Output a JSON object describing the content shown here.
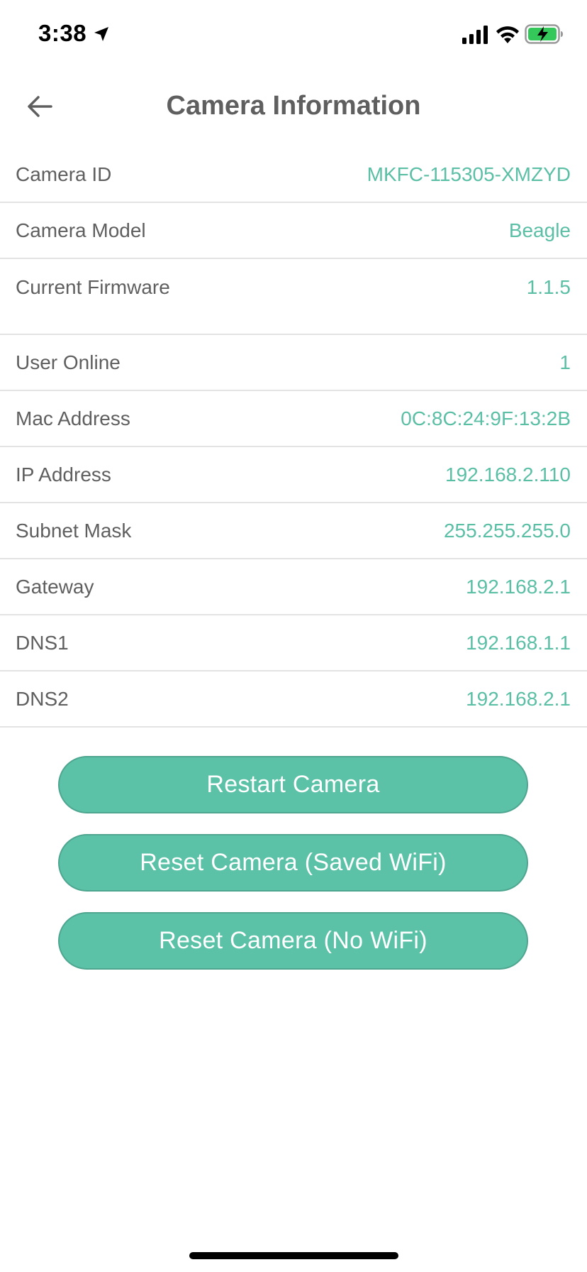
{
  "status_bar": {
    "time": "3:38"
  },
  "header": {
    "title": "Camera Information"
  },
  "info": [
    {
      "label": "Camera ID",
      "value": "MKFC-115305-XMZYD"
    },
    {
      "label": "Camera Model",
      "value": "Beagle"
    },
    {
      "label": "Current Firmware",
      "value": "1.1.5"
    },
    {
      "label": "User Online",
      "value": "1"
    },
    {
      "label": "Mac Address",
      "value": "0C:8C:24:9F:13:2B"
    },
    {
      "label": "IP Address",
      "value": "192.168.2.110"
    },
    {
      "label": "Subnet Mask",
      "value": "255.255.255.0"
    },
    {
      "label": "Gateway",
      "value": "192.168.2.1"
    },
    {
      "label": "DNS1",
      "value": "192.168.1.1"
    },
    {
      "label": "DNS2",
      "value": "192.168.2.1"
    }
  ],
  "actions": {
    "restart_label": "Restart Camera",
    "reset_saved_wifi_label": "Reset Camera (Saved WiFi)",
    "reset_no_wifi_label": "Reset Camera (No WiFi)"
  },
  "colors": {
    "accent": "#5bc2a8",
    "value_text": "#5bbfa6",
    "label_text": "#5f5f5f",
    "divider": "#e3e3e3",
    "battery_charging": "#34c759"
  },
  "icons": {
    "status": [
      "location-arrow-icon",
      "signal-icon",
      "wifi-icon",
      "battery-charging-icon"
    ],
    "header": [
      "back-arrow-icon"
    ]
  }
}
